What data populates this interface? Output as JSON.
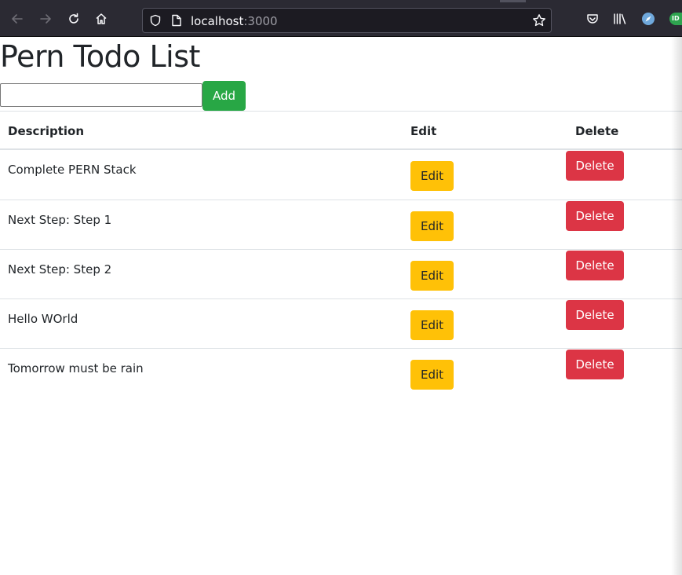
{
  "browser": {
    "url_host": "localhost",
    "url_port": ":3000"
  },
  "page": {
    "title": "Pern Todo List",
    "input_value": "",
    "add_label": "Add"
  },
  "table": {
    "headers": {
      "description": "Description",
      "edit": "Edit",
      "delete": "Delete"
    },
    "rows": [
      {
        "description": "Complete PERN Stack",
        "edit_label": "Edit",
        "delete_label": "Delete"
      },
      {
        "description": "Next Step: Step 1",
        "edit_label": "Edit",
        "delete_label": "Delete"
      },
      {
        "description": "Next Step: Step 2",
        "edit_label": "Edit",
        "delete_label": "Delete"
      },
      {
        "description": "Hello WOrld",
        "edit_label": "Edit",
        "delete_label": "Delete"
      },
      {
        "description": "Tomorrow must be rain",
        "edit_label": "Edit",
        "delete_label": "Delete"
      }
    ]
  },
  "colors": {
    "add_button": "#28a745",
    "edit_button": "#ffc107",
    "delete_button": "#dc3545",
    "toolbar_bg": "#2b2a33"
  }
}
